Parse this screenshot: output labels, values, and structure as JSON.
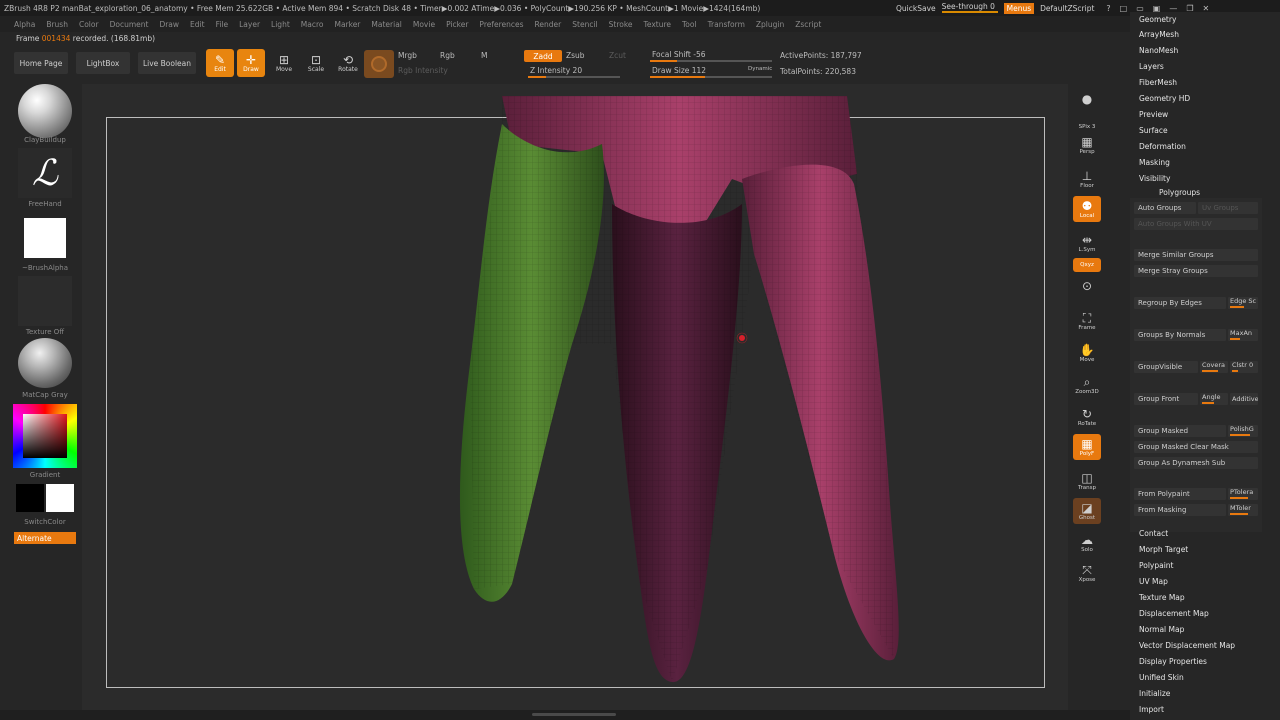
{
  "titlebar": {
    "title": "ZBrush 4R8 P2    manBat_exploration_06_anatomy    • Free Mem 25.622GB • Active Mem 894 • Scratch Disk 48 • Timer▶0.002 ATime▶0.036 • PolyCount▶190.256 KP • MeshCount▶1  Movie▶1424(164mb)",
    "quicksave": "QuickSave",
    "seethrough": "See-through  0",
    "menus": "Menus",
    "defaultscript": "DefaultZScript",
    "window_icons": [
      "?",
      "□",
      "▭",
      "▣",
      "—",
      "❐",
      "✕"
    ]
  },
  "menubar": [
    "Alpha",
    "Brush",
    "Color",
    "Document",
    "Draw",
    "Edit",
    "File",
    "Layer",
    "Light",
    "Macro",
    "Marker",
    "Material",
    "Movie",
    "Picker",
    "Preferences",
    "Render",
    "Stencil",
    "Stroke",
    "Texture",
    "Tool",
    "Transform",
    "Zplugin",
    "Zscript"
  ],
  "frameinfo": {
    "prefix": "Frame ",
    "frame": "001434",
    "suffix": " recorded. (168.81mb)"
  },
  "toolbar": {
    "home": "Home Page",
    "lightbox": "LightBox",
    "liveboolean": "Live Boolean",
    "edit": "Edit",
    "draw": "Draw",
    "move": "Move",
    "scale": "Scale",
    "rotate": "Rotate",
    "mrgb": "Mrgb",
    "rgb": "Rgb",
    "m": "M",
    "rgb_intensity": "Rgb Intensity",
    "zadd": "Zadd",
    "zsub": "Zsub",
    "zcut": "Zcut",
    "z_intensity": "Z Intensity 20",
    "focal_shift": "Focal Shift -56",
    "draw_size": "Draw Size 112",
    "dynamic": "Dynamic",
    "active_points": "ActivePoints: 187,797",
    "total_points": "TotalPoints: 220,583",
    "z_intensity_level": 0.2,
    "focal_shift_level": 0.22,
    "draw_size_level": 0.45
  },
  "lefttray": {
    "brush": "ClayBuildup",
    "stroke": "FreeHand",
    "alpha": "~BrushAlpha",
    "texture": "Texture Off",
    "material": "MatCap Gray",
    "gradient": "Gradient",
    "switchcolor": "SwitchColor",
    "alternate": "Alternate"
  },
  "rightshelf": {
    "spix": "SPix 3",
    "persp": "Persp",
    "floor": "Floor",
    "local": "Local",
    "lsym": "L.Sym",
    "qxyz": "Qxyz",
    "frame": "Frame",
    "move": "Move",
    "zoom3d": "Zoom3D",
    "rotate": "RoTate",
    "polyf": "PolyF",
    "transp": "Transp",
    "ghost": "Ghost",
    "solo": "Solo",
    "xpose": "Xpose"
  },
  "rightpanel": {
    "top_items": [
      "Geometry",
      "ArrayMesh",
      "NanoMesh",
      "Layers",
      "FiberMesh",
      "Geometry HD",
      "Preview",
      "Surface",
      "Deformation",
      "Masking",
      "Visibility"
    ],
    "polygroups": {
      "header": "Polygroups",
      "auto_groups": "Auto Groups",
      "uv_groups": "Uv Groups",
      "auto_groups_uv": "Auto Groups With UV",
      "merge_similar": "Merge Similar Groups",
      "merge_stray": "Merge Stray Groups",
      "regroup_edges": "Regroup By Edges",
      "edge_sc": "Edge Sc",
      "groups_normals": "Groups By Normals",
      "maxang": "MaxAn",
      "group_visible": "GroupVisible",
      "coverage": "Covera",
      "clstr": "Clstr 0",
      "group_front": "Group Front",
      "angle": "Angle",
      "additive": "Additive",
      "group_masked": "Group Masked",
      "polishg": "PolishG",
      "group_masked_clear": "Group Masked Clear Mask",
      "group_dynamesh": "Group As Dynamesh Sub",
      "from_polypaint": "From Polypaint",
      "ptolera": "PTolera",
      "from_masking": "From Masking",
      "mtoler": "MToler"
    },
    "bottom_items": [
      "Contact",
      "Morph Target",
      "Polypaint",
      "UV Map",
      "Texture Map",
      "Displacement Map",
      "Normal Map",
      "Vector Displacement Map",
      "Display Properties",
      "Unified Skin",
      "Initialize",
      "Import"
    ]
  },
  "colors": {
    "accent": "#e8790f",
    "model_green": "#4a7a2c",
    "model_pink": "#b0456f"
  }
}
